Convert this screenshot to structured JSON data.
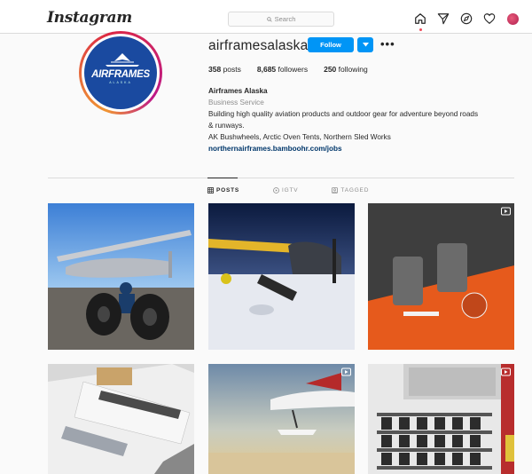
{
  "nav": {
    "logo": "Instagram",
    "search_placeholder": "Search",
    "icons": [
      "home-icon",
      "direct-icon",
      "explore-icon",
      "activity-heart-icon",
      "profile-avatar"
    ]
  },
  "profile": {
    "username": "airframesalaska",
    "follow_label": "Follow",
    "avatar_brand": "AIRFRAMES",
    "avatar_sub": "ALASKA",
    "stats": {
      "posts_count": "358",
      "posts_label": "posts",
      "followers_count": "8,685",
      "followers_label": "followers",
      "following_count": "250",
      "following_label": "following"
    },
    "bio": {
      "name": "Airframes Alaska",
      "category": "Business Service",
      "line1": "Building high quality aviation products and outdoor gear for adventure beyond roads",
      "line2": "& runways.",
      "line3": "AK Bushwheels, Arctic Oven Tents, Northern Sled Works",
      "link": "northernairframes.bamboohr.com/jobs"
    }
  },
  "tabs": [
    {
      "label": "POSTS",
      "active": true
    },
    {
      "label": "IGTV",
      "active": false
    },
    {
      "label": "TAGGED",
      "active": false
    }
  ],
  "posts": [
    {
      "kind": "image",
      "scene": "man kneeling with large tundra tires beside a bush plane"
    },
    {
      "kind": "image",
      "scene": "yellow bush plane on snow at dusk"
    },
    {
      "kind": "video",
      "scene": "orange aircraft cockpit interior"
    },
    {
      "kind": "image",
      "scene": "tire box with stickers"
    },
    {
      "kind": "video",
      "scene": "bush plane with skis flying over ice"
    },
    {
      "kind": "video",
      "scene": "warehouse storage shelves"
    }
  ],
  "colors": {
    "accent_blue": "#0095f6",
    "link_blue": "#00376b",
    "muted": "#8e8e8e",
    "text": "#262626",
    "avatar_blue": "#1a4aa0"
  }
}
